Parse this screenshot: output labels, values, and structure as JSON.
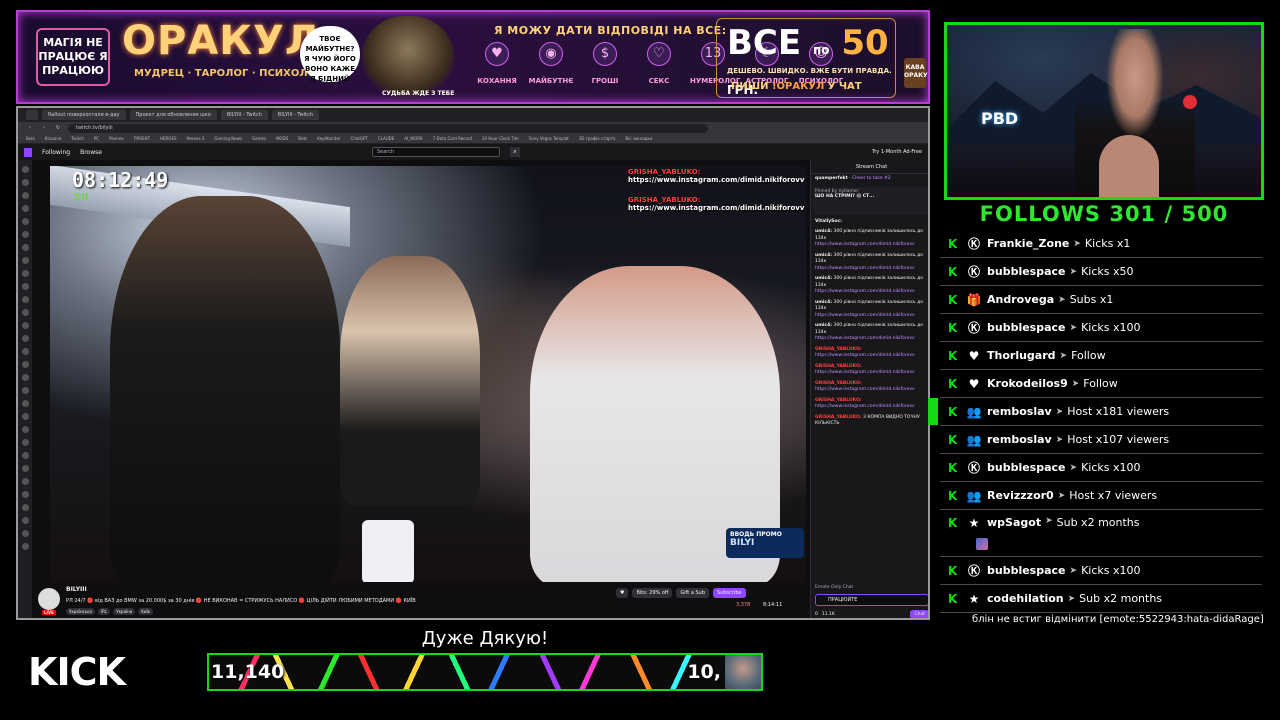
{
  "banner": {
    "tag": "МАГІЯ НЕ ПРАЦЮЄ Я ПРАЦЮЮ",
    "brand": "ОРАКУЛ",
    "brand_sub": "МУДРЕЦ · ТАРОЛОГ · ПСИХОЛОГ",
    "bubble": "ТВОЄ МАЙБУТНЄ? Я ЧУЮ ЙОГО ВОНО КАЖЕ Я БІДНИЙ",
    "fate": "СУДЬБА ЖДЕ З ТЕБЕ",
    "answer": "Я МОЖУ ДАТИ ВІДПОВІДІ НА ВСЕ:",
    "categories": [
      {
        "label": "КОХАННЯ",
        "icon": "heart-icon",
        "glyph": "♥"
      },
      {
        "label": "МАЙБУТНЄ",
        "icon": "crystal-ball-icon",
        "glyph": "◉"
      },
      {
        "label": "ГРОШІ",
        "icon": "money-icon",
        "glyph": "$"
      },
      {
        "label": "СЕКС",
        "icon": "peach-icon",
        "glyph": "♡"
      },
      {
        "label": "НУМЕРОЛОГ",
        "icon": "numbers-icon",
        "glyph": "13"
      },
      {
        "label": "АСТРОЛОГ",
        "icon": "moon-icon",
        "glyph": "☾"
      },
      {
        "label": "ПСИХОЛОГ",
        "icon": "head-icon",
        "glyph": "☺"
      }
    ],
    "price_big": "ВСЕ",
    "price_by": "по",
    "price_num": "50",
    "price_cur": "ГРН.",
    "price_small": "ДЕШЕВО. ШВИДКО. ВЖЕ БУТИ ПРАВДА.",
    "cta_prefix": "ПИШИ",
    "cta_cmd": "!ОРАКУЛ",
    "cta_suffix": "У ЧАТ",
    "cup": "КАВА ОРАКУЛА",
    "colors": {
      "border": "#b83cd6",
      "gold": "#ffd27a"
    }
  },
  "browser": {
    "tabs": [
      "",
      "Rallout поверхостали в-дау",
      "Проект для обновления шко",
      "BILYIII - Twitch",
      "BILYIII - Twitch"
    ],
    "url": "twitch.tv/bilyiii",
    "bookmarks": [
      "Bots",
      "Kravane",
      "Twitch",
      "PC",
      "Pannex",
      "ПРОЕКТ",
      "HEROES",
      "Heroes 3",
      "Gaming News",
      "Games",
      "MODS",
      "Bots",
      "KeyAboriter",
      "ChatGPT",
      "CLAUDE",
      "AI_WORK",
      "7-Data Card Record",
      "24 Hour Clock Tim",
      "Sony Vegas Templat",
      "3D графік старта",
      "Всі закладки"
    ]
  },
  "twitch": {
    "following": "Following",
    "browse": "Browse",
    "search_placeholder": "Search",
    "ad_free": "Try 1-Month Ad-Free",
    "video": {
      "clock": "08:12:49",
      "clock_sub": "SII",
      "overlay": [
        {
          "user": "GRISHA_YABLUKO:",
          "link": "https://www.instagram.com/dimid.nikiforovv"
        },
        {
          "user": "GRISHA_YABLUKO:",
          "link": "https://www.instagram.com/dimid.nikiforovv"
        }
      ],
      "promo_label": "ВВОДЬ ПРОМО",
      "promo_code": "BILYI"
    },
    "info": {
      "channel": "BILYIII",
      "title": "РЛ 24/7 🔴 від ВАЗ до BMW за 20.000$ за 30 днів 🔴 НЕ ВИКОНАВ = СТРИЖУСЬ НАЛИСО 🔴 ЦІЛЬ ДІЙТИ ЛЮБИМИ МЕТОДАМИ 🔴 КИЇВ",
      "tags": [
        "Українська",
        "IRL",
        "Україна",
        "Kиїв"
      ],
      "live": "LIVE",
      "bits": "Bits: 29% off",
      "gift": "Gift a Sub",
      "subscribe": "Subscribe",
      "viewers": "3,378",
      "uptime": "8:14:11"
    },
    "chat": {
      "header": "Stream Chat",
      "cheer_user": "quamperfekt",
      "cheer_text": "Cheer to take #2",
      "pinned_by": "Pinned by nyllamor",
      "pinned_text": "ШО НА СТРІМІ? 😱 СТ...",
      "messages": [
        {
          "user": "VitallySoc:",
          "text": ""
        },
        {
          "user": "umic4:",
          "text": "300 рівно підписників залишилось до 134к",
          "link": "https://www.instagram.com/dimid.nikiforovv"
        },
        {
          "user": "umic4:",
          "text": "300 рівно підписників залишилось до 134к",
          "link": "https://www.instagram.com/dimid.nikiforovv"
        },
        {
          "user": "umic4:",
          "text": "300 рівно підписників залишилось до 134к",
          "link": "https://www.instagram.com/dimid.nikiforovv"
        },
        {
          "user": "umic4:",
          "text": "300 рівно підписників залишилось до 134к",
          "link": "https://www.instagram.com/dimid.nikiforovv"
        },
        {
          "user": "umic4:",
          "text": "300 рівно підписників залишилось до 134к",
          "link": "https://www.instagram.com/dimid.nikiforovv"
        },
        {
          "user": "GRISHA_YABLUKO:",
          "text": "",
          "link": "https://www.instagram.com/dimid.nikiforovv"
        },
        {
          "user": "GRISHA_YABLUKO:",
          "text": "",
          "link": "https://www.instagram.com/dimid.nikiforovv"
        },
        {
          "user": "GRISHA_YABLUKO:",
          "text": "",
          "link": "https://www.instagram.com/dimid.nikiforovv"
        },
        {
          "user": "GRISHA_YABLUKO:",
          "text": "",
          "link": "https://www.instagram.com/dimid.nikiforovv"
        },
        {
          "user": "GRISHA_YABLUKO:",
          "text": "З КОМПА ВИДНО ТОЧНУ КІЛЬКІСТЬ",
          "link": ""
        }
      ],
      "emote_only": "Emote Only Chat",
      "input_value": "ПРАЦЮЙТЕ",
      "points": "11.1K",
      "zero": "0",
      "chat_button": "Chat"
    }
  },
  "follows": "FOLLOWS 301 / 500",
  "events": [
    {
      "user": "Frankie_Zone",
      "action": "Kicks x1",
      "icon": "kick-coin-icon",
      "glyph": "Ⓚ",
      "bar": false
    },
    {
      "user": "bubblespace",
      "action": "Kicks x50",
      "icon": "kick-coin-icon",
      "glyph": "Ⓚ",
      "bar": false
    },
    {
      "user": "Androvega",
      "action": "Subs x1",
      "icon": "gift-icon",
      "glyph": "🎁",
      "bar": false
    },
    {
      "user": "bubblespace",
      "action": "Kicks x100",
      "icon": "kick-coin-icon",
      "glyph": "Ⓚ",
      "bar": false
    },
    {
      "user": "Thorlugard",
      "action": "Follow",
      "icon": "heart-icon",
      "glyph": "♥",
      "bar": false
    },
    {
      "user": "Krokodeilos9",
      "action": "Follow",
      "icon": "heart-icon",
      "glyph": "♥",
      "bar": false
    },
    {
      "user": "remboslav",
      "action": "Host x181 viewers",
      "icon": "host-icon",
      "glyph": "👥",
      "bar": true
    },
    {
      "user": "remboslav",
      "action": "Host x107 viewers",
      "icon": "host-icon",
      "glyph": "👥",
      "bar": false
    },
    {
      "user": "bubblespace",
      "action": "Kicks x100",
      "icon": "kick-coin-icon",
      "glyph": "Ⓚ",
      "bar": false
    },
    {
      "user": "Revizzzor0",
      "action": "Host x7 viewers",
      "icon": "host-icon",
      "glyph": "👥",
      "bar": false
    },
    {
      "user": "wpSagot",
      "action": "Sub x2 months",
      "icon": "star-icon",
      "glyph": "★",
      "bar": false,
      "tall": true
    },
    {
      "user": "bubblespace",
      "action": "Kicks x100",
      "icon": "kick-coin-icon",
      "glyph": "Ⓚ",
      "bar": false
    },
    {
      "user": "codehilation",
      "action": "Sub x2 months",
      "icon": "star-icon",
      "glyph": "★",
      "bar": false,
      "message": "блін не встиг відмінити [emote:5522943:hata-didaRage]"
    }
  ],
  "bottom": {
    "kick_logo": "KICK",
    "thanks": "Дуже Дякую!",
    "goal_current": "11,140",
    "goal_target": "10,",
    "colors": {
      "accent": "#16d916"
    }
  }
}
